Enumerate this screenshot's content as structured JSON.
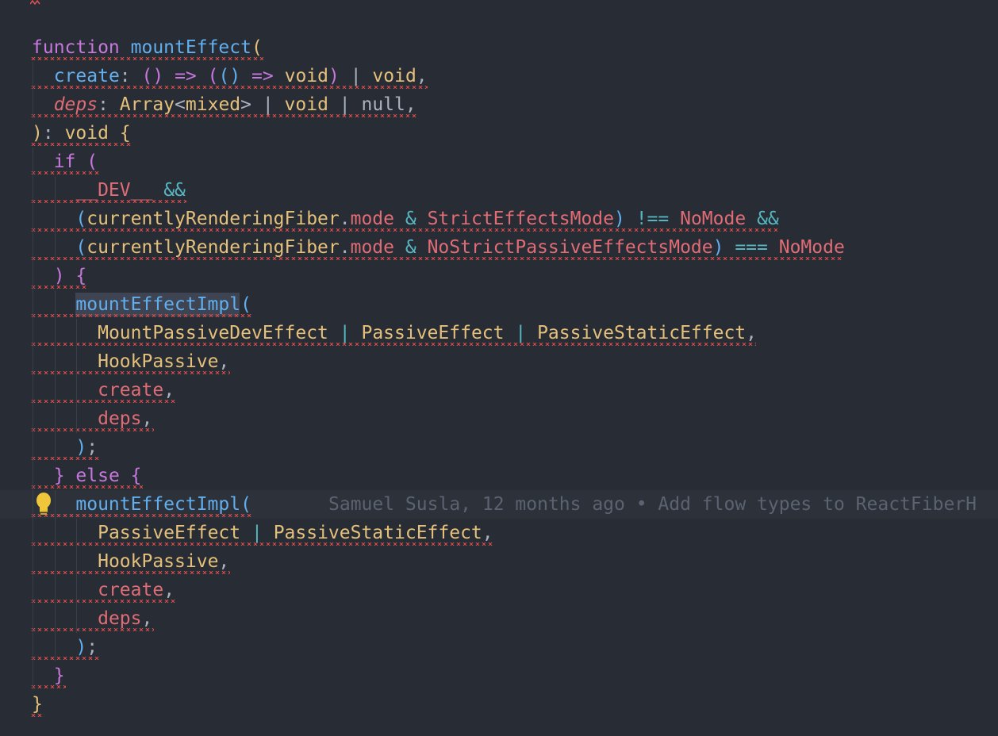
{
  "editor": {
    "language": "flow/javascript",
    "lines": [
      {
        "indent": "",
        "tokens": [
          [
            "kw",
            "function"
          ],
          [
            "plain",
            " "
          ],
          [
            "fn",
            "mountEffect"
          ],
          [
            "paren1",
            "("
          ]
        ]
      },
      {
        "indent": "  ",
        "tokens": [
          [
            "fn",
            "create"
          ],
          [
            "plain",
            ": "
          ],
          [
            "paren2",
            "()"
          ],
          [
            "plain",
            " "
          ],
          [
            "kw",
            "=>"
          ],
          [
            "plain",
            " "
          ],
          [
            "paren2",
            "("
          ],
          [
            "paren3",
            "()"
          ],
          [
            "plain",
            " "
          ],
          [
            "kw",
            "=>"
          ],
          [
            "plain",
            " "
          ],
          [
            "type",
            "void"
          ],
          [
            "paren2",
            ")"
          ],
          [
            "plain",
            " | "
          ],
          [
            "type",
            "void"
          ],
          [
            "plain",
            ","
          ]
        ]
      },
      {
        "indent": "  ",
        "tokens": [
          [
            "ital",
            "deps"
          ],
          [
            "plain",
            ": "
          ],
          [
            "type",
            "Array"
          ],
          [
            "plain",
            "<"
          ],
          [
            "type",
            "mixed"
          ],
          [
            "plain",
            "> | "
          ],
          [
            "type",
            "void"
          ],
          [
            "plain",
            " | "
          ],
          [
            "plain",
            "null"
          ],
          [
            "plain",
            ","
          ]
        ]
      },
      {
        "indent": "",
        "tokens": [
          [
            "paren1",
            ")"
          ],
          [
            "plain",
            ": "
          ],
          [
            "type",
            "void"
          ],
          [
            "plain",
            " "
          ],
          [
            "paren1",
            "{"
          ]
        ]
      },
      {
        "indent": "  ",
        "tokens": [
          [
            "kw",
            "if"
          ],
          [
            "plain",
            " "
          ],
          [
            "paren2",
            "("
          ]
        ]
      },
      {
        "indent": "    ",
        "tokens": [
          [
            "var",
            "__DEV__"
          ],
          [
            "plain",
            " "
          ],
          [
            "op",
            "&&"
          ]
        ]
      },
      {
        "indent": "    ",
        "tokens": [
          [
            "paren3",
            "("
          ],
          [
            "type",
            "currentlyRenderingFiber"
          ],
          [
            "plain",
            "."
          ],
          [
            "prop",
            "mode"
          ],
          [
            "plain",
            " "
          ],
          [
            "op",
            "&"
          ],
          [
            "plain",
            " "
          ],
          [
            "var",
            "StrictEffectsMode"
          ],
          [
            "paren3",
            ")"
          ],
          [
            "plain",
            " "
          ],
          [
            "op",
            "!=="
          ],
          [
            "plain",
            " "
          ],
          [
            "var",
            "NoMode"
          ],
          [
            "plain",
            " "
          ],
          [
            "op",
            "&&"
          ]
        ]
      },
      {
        "indent": "    ",
        "tokens": [
          [
            "paren3",
            "("
          ],
          [
            "type",
            "currentlyRenderingFiber"
          ],
          [
            "plain",
            "."
          ],
          [
            "prop",
            "mode"
          ],
          [
            "plain",
            " "
          ],
          [
            "op",
            "&"
          ],
          [
            "plain",
            " "
          ],
          [
            "var",
            "NoStrictPassiveEffectsMode"
          ],
          [
            "paren3",
            ")"
          ],
          [
            "plain",
            " "
          ],
          [
            "op",
            "==="
          ],
          [
            "plain",
            " "
          ],
          [
            "var",
            "NoMode"
          ]
        ]
      },
      {
        "indent": "  ",
        "tokens": [
          [
            "paren2",
            ")"
          ],
          [
            "plain",
            " "
          ],
          [
            "paren2",
            "{"
          ]
        ]
      },
      {
        "indent": "    ",
        "tokens": [
          [
            "fn",
            "mountEffectImpl"
          ],
          [
            "paren3",
            "("
          ]
        ]
      },
      {
        "indent": "      ",
        "tokens": [
          [
            "type",
            "MountPassiveDevEffect"
          ],
          [
            "plain",
            " "
          ],
          [
            "op",
            "|"
          ],
          [
            "plain",
            " "
          ],
          [
            "type",
            "PassiveEffect"
          ],
          [
            "plain",
            " "
          ],
          [
            "op",
            "|"
          ],
          [
            "plain",
            " "
          ],
          [
            "type",
            "PassiveStaticEffect"
          ],
          [
            "plain",
            ","
          ]
        ]
      },
      {
        "indent": "      ",
        "tokens": [
          [
            "type",
            "HookPassive"
          ],
          [
            "plain",
            ","
          ]
        ]
      },
      {
        "indent": "      ",
        "tokens": [
          [
            "var",
            "create"
          ],
          [
            "plain",
            ","
          ]
        ]
      },
      {
        "indent": "      ",
        "tokens": [
          [
            "var",
            "deps"
          ],
          [
            "plain",
            ","
          ]
        ]
      },
      {
        "indent": "    ",
        "tokens": [
          [
            "paren3",
            ")"
          ],
          [
            "plain",
            ";"
          ]
        ]
      },
      {
        "indent": "  ",
        "tokens": [
          [
            "paren2",
            "}"
          ],
          [
            "plain",
            " "
          ],
          [
            "kw",
            "else"
          ],
          [
            "plain",
            " "
          ],
          [
            "paren2",
            "{"
          ]
        ]
      },
      {
        "indent": "    ",
        "tokens": [
          [
            "fn",
            "mountEffectImpl"
          ],
          [
            "paren3",
            "("
          ]
        ]
      },
      {
        "indent": "      ",
        "tokens": [
          [
            "type",
            "PassiveEffect"
          ],
          [
            "plain",
            " "
          ],
          [
            "op",
            "|"
          ],
          [
            "plain",
            " "
          ],
          [
            "type",
            "PassiveStaticEffect"
          ],
          [
            "plain",
            ","
          ]
        ]
      },
      {
        "indent": "      ",
        "tokens": [
          [
            "type",
            "HookPassive"
          ],
          [
            "plain",
            ","
          ]
        ]
      },
      {
        "indent": "      ",
        "tokens": [
          [
            "var",
            "create"
          ],
          [
            "plain",
            ","
          ]
        ]
      },
      {
        "indent": "      ",
        "tokens": [
          [
            "var",
            "deps"
          ],
          [
            "plain",
            ","
          ]
        ]
      },
      {
        "indent": "    ",
        "tokens": [
          [
            "paren3",
            ")"
          ],
          [
            "plain",
            ";"
          ]
        ]
      },
      {
        "indent": "  ",
        "tokens": [
          [
            "paren2",
            "}"
          ]
        ]
      },
      {
        "indent": "",
        "tokens": [
          [
            "paren1",
            "}"
          ]
        ]
      }
    ],
    "blame": {
      "text": "Samuel Susla, 12 months ago • Add flow types to ReactFiberH"
    },
    "current_line_index": 16,
    "lightbulb_icon": "lightbulb-icon",
    "colors": {
      "background": "#282c34",
      "current_line": "#2c313a",
      "squiggle": "#e05252",
      "selection_border": "#528bff"
    }
  }
}
